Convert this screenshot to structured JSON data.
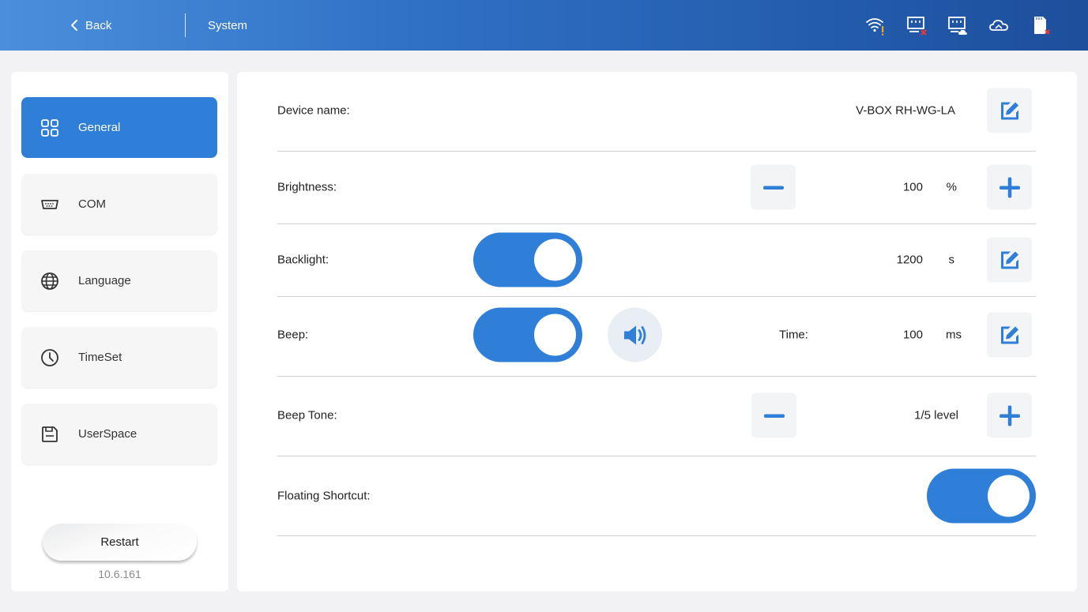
{
  "header": {
    "back_label": "Back",
    "title": "System",
    "status_icons": [
      "wifi-warning-icon",
      "lan-disconnected-icon",
      "lan-cloud-icon",
      "cloud-icon",
      "sd-card-missing-icon"
    ]
  },
  "sidebar": {
    "items": [
      {
        "label": "General",
        "icon": "grid-icon",
        "active": true
      },
      {
        "label": "COM",
        "icon": "serial-port-icon",
        "active": false
      },
      {
        "label": "Language",
        "icon": "globe-icon",
        "active": false
      },
      {
        "label": "TimeSet",
        "icon": "clock-icon",
        "active": false
      },
      {
        "label": "UserSpace",
        "icon": "save-icon",
        "active": false
      }
    ],
    "restart_label": "Restart",
    "version": "10.6.161"
  },
  "settings": {
    "device_name": {
      "label": "Device name:",
      "value": "V-BOX RH-WG-LA"
    },
    "brightness": {
      "label": "Brightness:",
      "value": "100",
      "unit": "%"
    },
    "backlight": {
      "label": "Backlight:",
      "enabled": true,
      "value": "1200",
      "unit": "s"
    },
    "beep": {
      "label": "Beep:",
      "enabled": true,
      "time_label": "Time:",
      "value": "100",
      "unit": "ms"
    },
    "beep_tone": {
      "label": "Beep Tone:",
      "value": "1/5 level"
    },
    "floating_shortcut": {
      "label": "Floating Shortcut:",
      "enabled": true
    }
  },
  "colors": {
    "accent": "#2f7fd8",
    "header_start": "#4a8fdc",
    "header_end": "#1c4f9c",
    "warning": "#f5a623",
    "error": "#e53935"
  }
}
